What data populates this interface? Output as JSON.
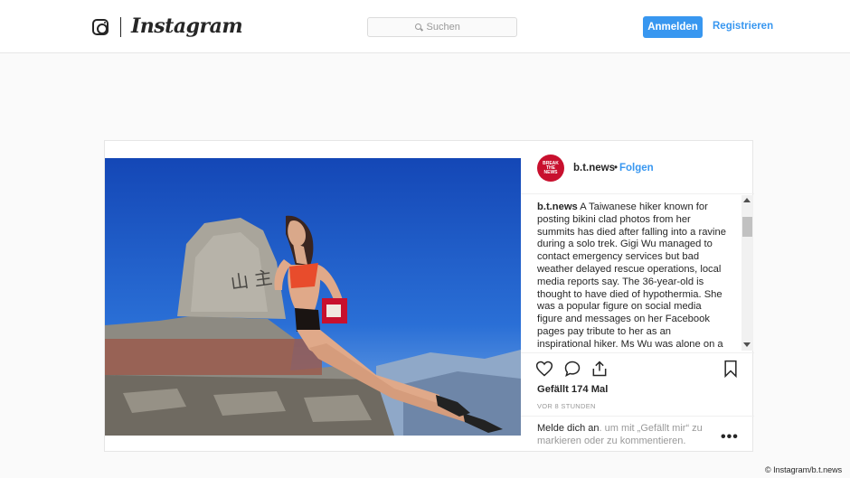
{
  "header": {
    "brand": "Instagram",
    "search": {
      "placeholder": "Suchen"
    },
    "login_label": "Anmelden",
    "register_label": "Registrieren"
  },
  "post": {
    "author": {
      "username": "b.t.news",
      "separator": "•",
      "follow_label": "Folgen",
      "avatar_lines": [
        "BREAK",
        "THE",
        "NEWS"
      ]
    },
    "caption": {
      "username": "b.t.news",
      "text": "A Taiwanese hiker known for posting bikini clad photos from her summits has died after falling into a ravine during a solo trek. Gigi Wu managed to contact emergency services but bad weather delayed rescue operations, local media reports say. The 36-year-old is thought to have died of hypothermia. She was a popular figure on social media figure and messages on her Facebook pages pay tribute to her as an inspirational hiker. Ms Wu was alone on a multi-day tour of a"
    },
    "likes": "Gefällt 174 Mal",
    "timestamp": "VOR 8 STUNDEN",
    "login_prompt": {
      "link": "Melde dich an",
      "rest": ". um mit „Gefällt mir“ zu markieren oder zu kommentieren."
    },
    "more_label": "•••"
  },
  "credit": "© Instagram/b.t.news",
  "colors": {
    "accent": "#3897f0",
    "avatar": "#c8102e",
    "sky": "#1d5fc4"
  }
}
